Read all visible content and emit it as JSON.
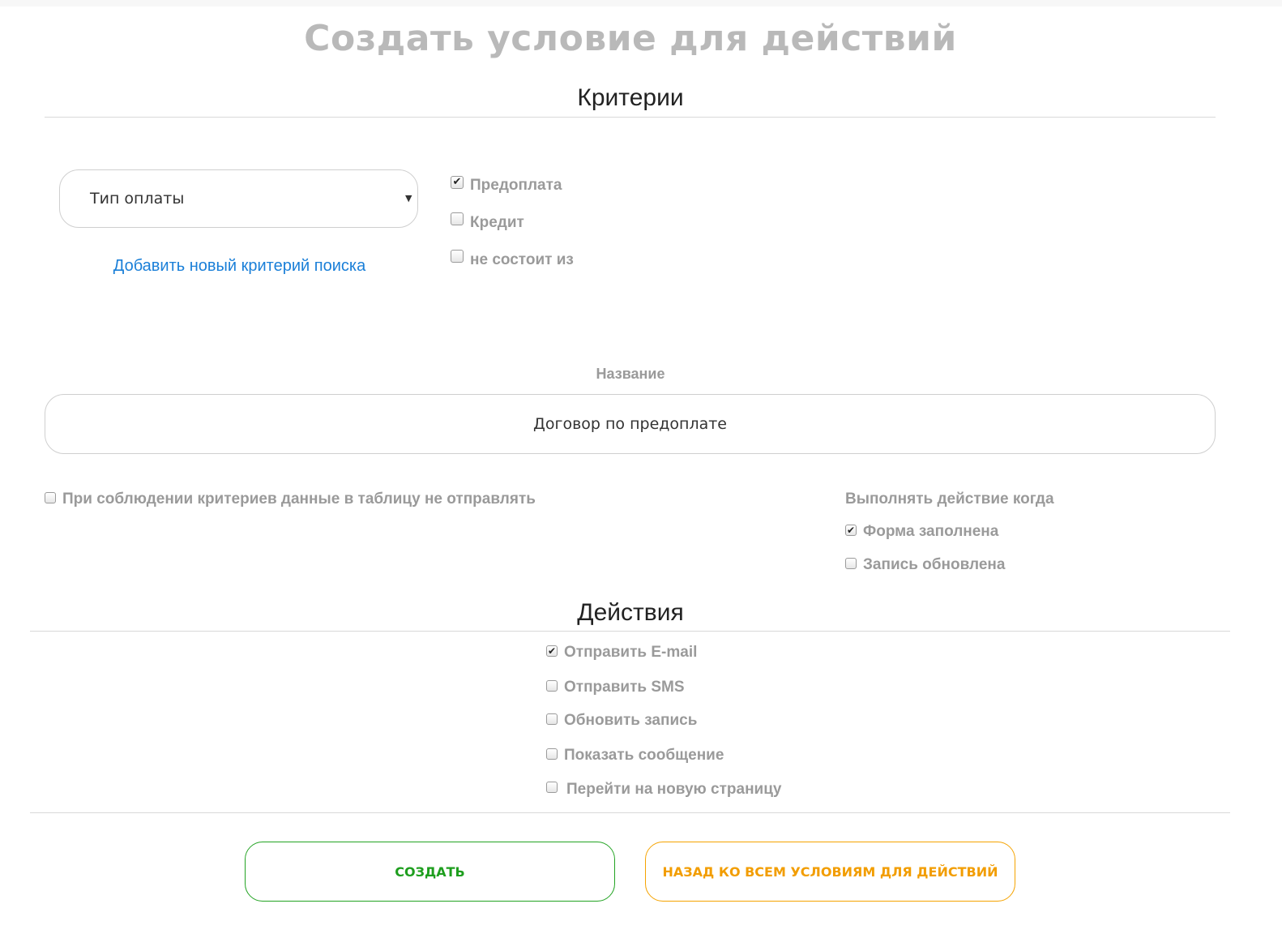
{
  "title": "Создать условие для действий",
  "criteria": {
    "heading": "Критерии",
    "select_value": "Тип оплаты",
    "add_link": "Добавить новый критерий поиска",
    "options": [
      {
        "label": "Предоплата",
        "checked": true
      },
      {
        "label": "Кредит",
        "checked": false
      },
      {
        "label": "не состоит из",
        "checked": false
      }
    ]
  },
  "name_field": {
    "label": "Название",
    "value": "Договор по предоплате"
  },
  "no_send": {
    "label": "При соблюдении критериев данные в таблицу не отправлять",
    "checked": false
  },
  "execute_when": {
    "label": "Выполнять действие когда",
    "options": [
      {
        "label": "Форма заполнена",
        "checked": true
      },
      {
        "label": "Запись обновлена",
        "checked": false
      }
    ]
  },
  "actions": {
    "heading": "Действия",
    "options": [
      {
        "label": "Отправить E-mail",
        "checked": true
      },
      {
        "label": "Отправить SMS",
        "checked": false
      },
      {
        "label": "Обновить запись",
        "checked": false
      },
      {
        "label": "Показать сообщение",
        "checked": false
      },
      {
        "label": "Перейти на новую страницу",
        "checked": false
      }
    ]
  },
  "buttons": {
    "create": "СОЗДАТЬ",
    "back": "НАЗАД КО ВСЕМ УСЛОВИЯМ ДЛЯ ДЕЙСТВИЙ"
  },
  "colors": {
    "title_gray": "#b9b9b9",
    "link_blue": "#1a7fd8",
    "create_green": "#1e9e1e",
    "back_orange": "#f29d00"
  }
}
